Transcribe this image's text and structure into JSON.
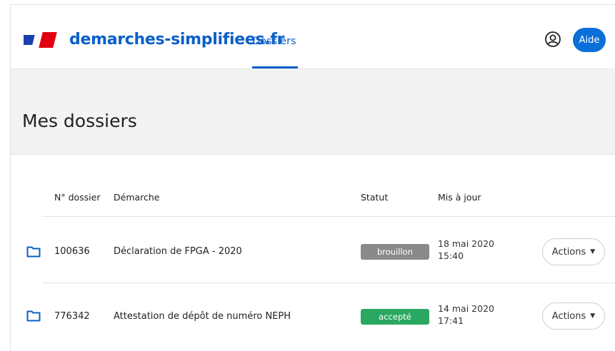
{
  "header": {
    "brand": "demarches-simplifiees.fr",
    "nav_tab": "Dossiers",
    "account_icon": "user-circle-icon",
    "help_button": "Aide",
    "accent_color": "#0b5fc9"
  },
  "page": {
    "title": "Mes dossiers"
  },
  "table": {
    "columns": {
      "number": "N° dossier",
      "procedure": "Démarche",
      "status": "Statut",
      "updated": "Mis à jour"
    },
    "rows": [
      {
        "icon": "folder-icon",
        "number": "100636",
        "procedure": "Déclaration de FPGA - 2020",
        "status": "brouillon",
        "status_color": "#8a8a8a",
        "date": "18 mai 2020",
        "time": "15:40",
        "actions": "Actions"
      },
      {
        "icon": "folder-icon",
        "number": "776342",
        "procedure": "Attestation de dépôt de numéro NEPH",
        "status": "accepté",
        "status_color": "#2aa861",
        "date": "14 mai 2020",
        "time": "17:41",
        "actions": "Actions"
      }
    ]
  }
}
